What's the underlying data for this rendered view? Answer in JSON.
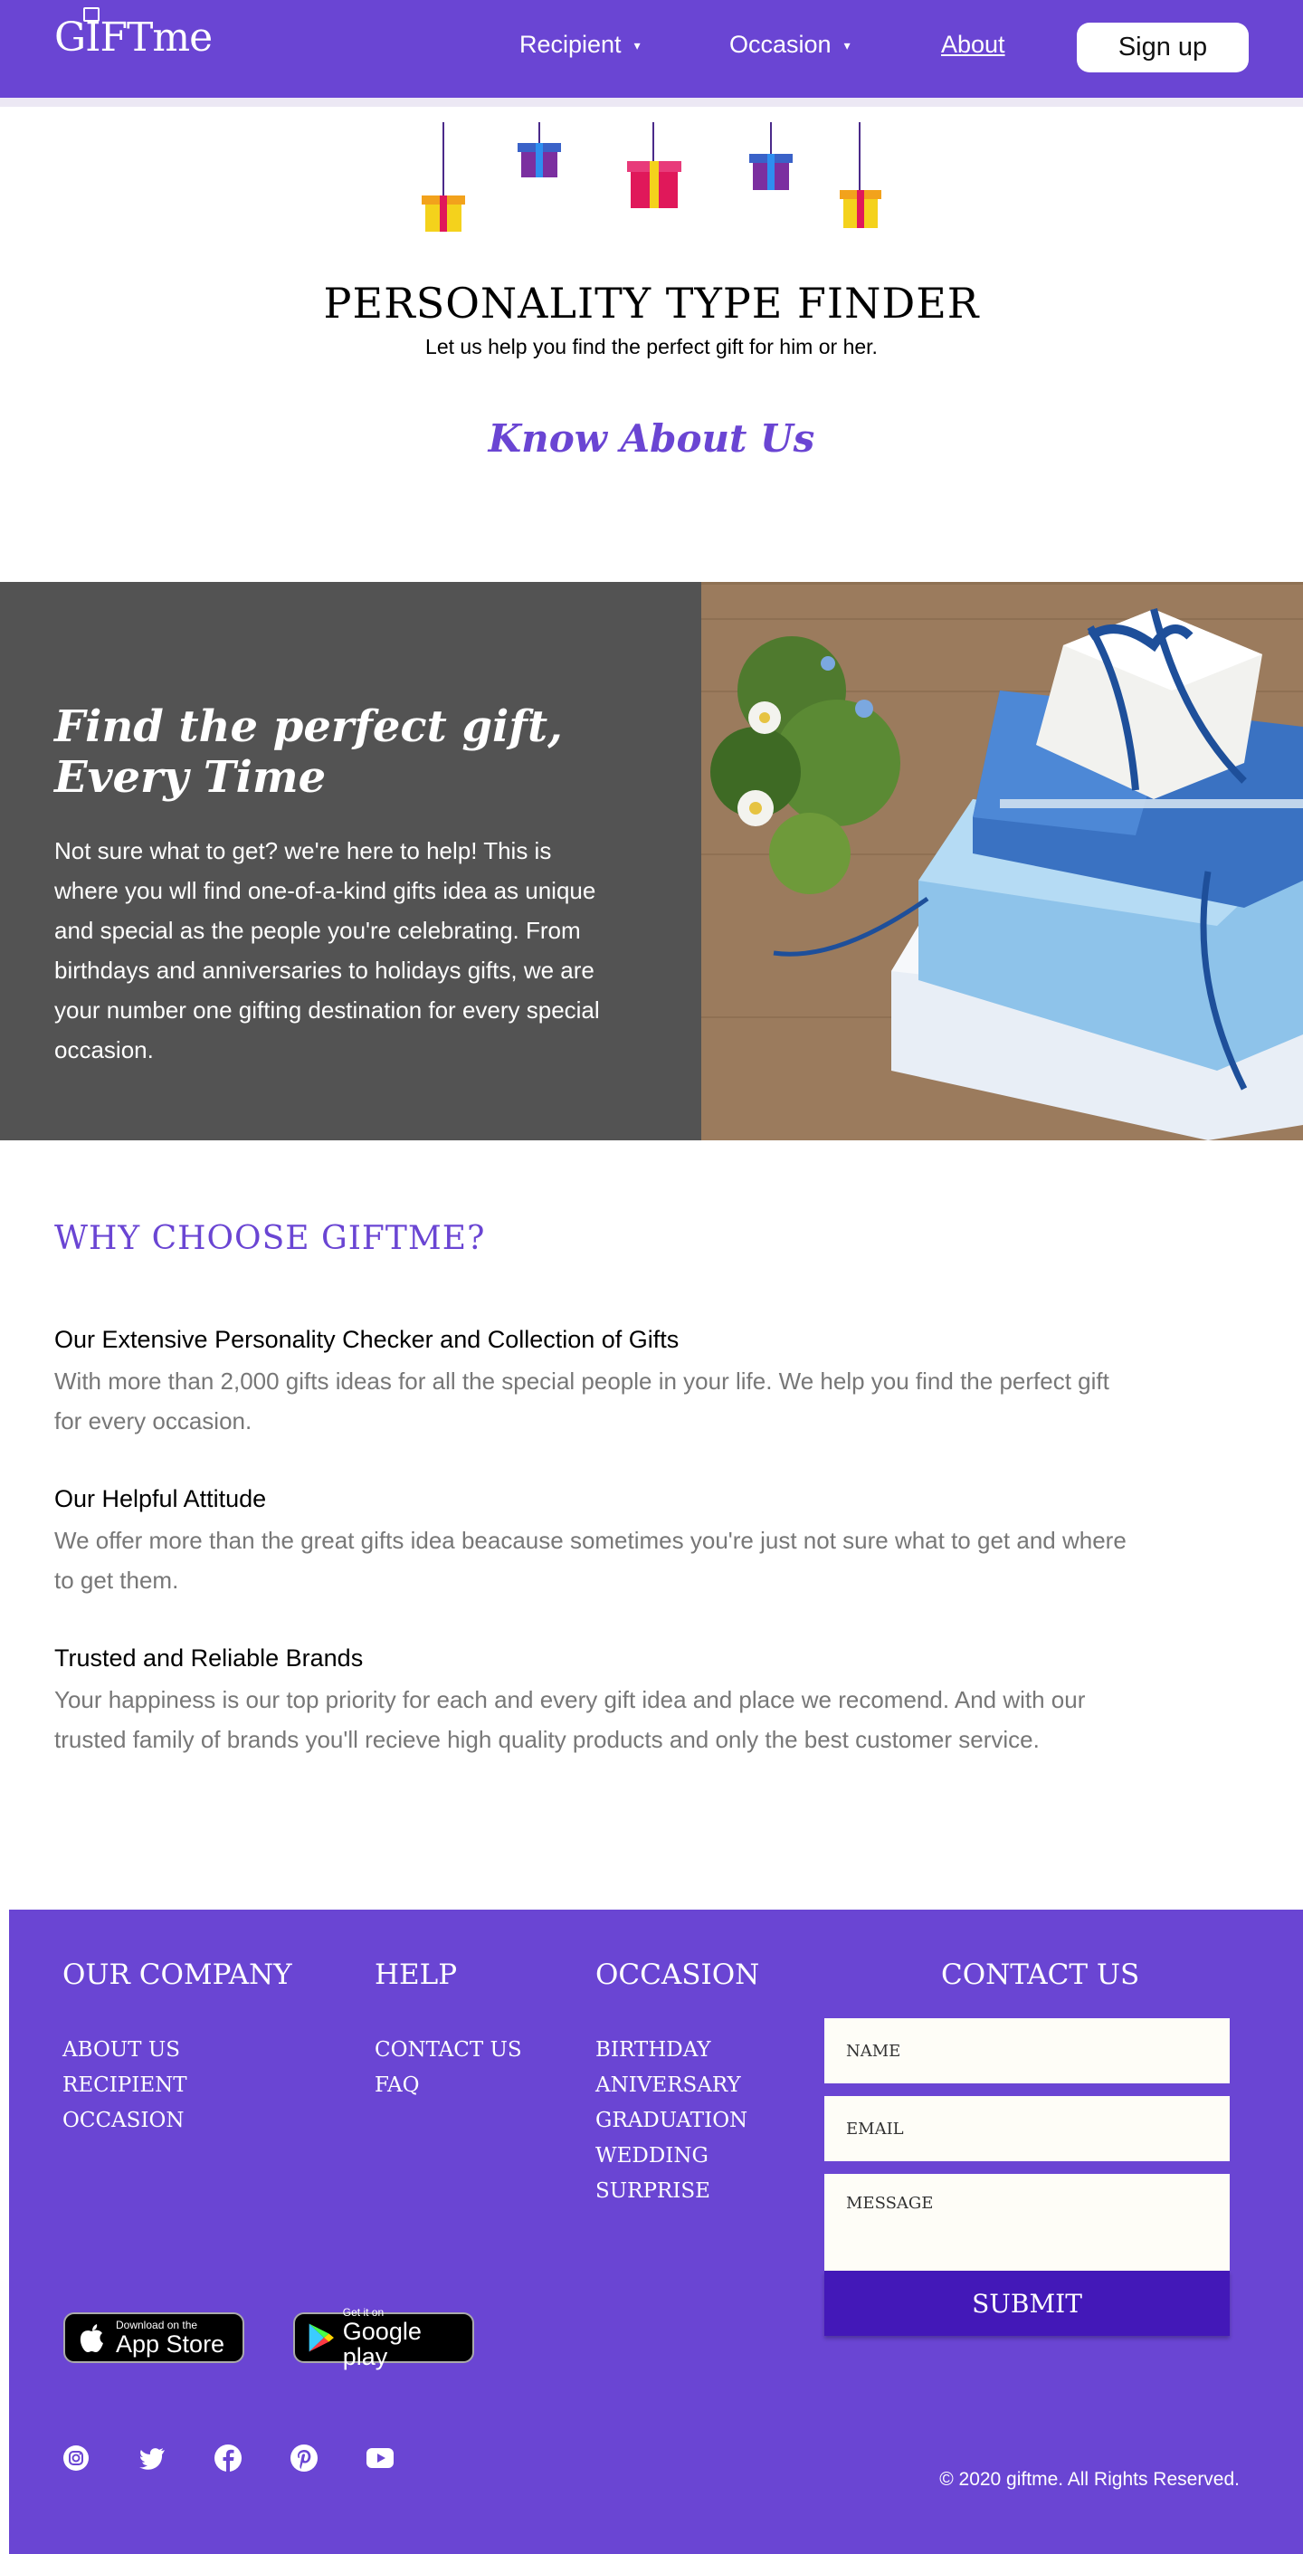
{
  "header": {
    "logo": "GIFTme",
    "nav": [
      {
        "label": "Recipient"
      },
      {
        "label": "Occasion"
      },
      {
        "label": "About"
      }
    ],
    "signup_label": "Sign up"
  },
  "hero": {
    "title": "PERSONALITY TYPE FINDER",
    "subtitle": "Let us help you find the perfect gift for him or her.",
    "link_label": "Know About Us"
  },
  "feature": {
    "heading": "Find the perfect gift, Every Time",
    "text": "Not sure what to get? we're here to help! This is where you wll find one-of-a-kind gifts idea as unique and special as the people you're celebrating. From birthdays and anniversaries to holidays gifts, we are your number one gifting destination for every special occasion."
  },
  "why": {
    "title": "WHY CHOOSE GIFTME?",
    "reasons": [
      {
        "title": "Our Extensive Personality Checker and Collection of Gifts",
        "text": "With more than 2,000 gifts ideas for all the special people in your life. We help you find the perfect gift for every occasion."
      },
      {
        "title": "Our Helpful Attitude",
        "text": "We offer more than the great gifts idea beacause sometimes you're just not sure what to get and where to get them."
      },
      {
        "title": "Trusted and Reliable Brands",
        "text": "Your happiness is our top priority for each and every gift idea and place we recomend. And with our trusted family of brands you'll recieve high quality products and only the best customer service."
      }
    ]
  },
  "footer": {
    "company": {
      "heading": "OUR COMPANY",
      "items": [
        "ABOUT US",
        "RECIPIENT",
        "OCCASION"
      ]
    },
    "help": {
      "heading": "HELP",
      "items": [
        "CONTACT US",
        "FAQ"
      ]
    },
    "occasion": {
      "heading": "OCCASION",
      "items": [
        "BIRTHDAY",
        "ANIVERSARY",
        "GRADUATION",
        "WEDDING",
        "SURPRISE"
      ]
    },
    "contact": {
      "heading": "CONTACT US",
      "name_placeholder": "NAME",
      "email_placeholder": "EMAIL",
      "message_placeholder": "MESSAGE",
      "submit_label": "SUBMIT"
    },
    "app_store": {
      "small": "Download on the",
      "big": "App Store"
    },
    "google_play": {
      "small": "Get it on",
      "big": "Google play"
    },
    "social_icons": [
      "instagram-icon",
      "twitter-icon",
      "facebook-icon",
      "pinterest-icon",
      "youtube-icon"
    ],
    "copyright": "© 2020 giftme.  All Rights Reserved."
  },
  "colors": {
    "brand": "#6a45d3",
    "submit": "#4318b8",
    "band": "#535353"
  }
}
